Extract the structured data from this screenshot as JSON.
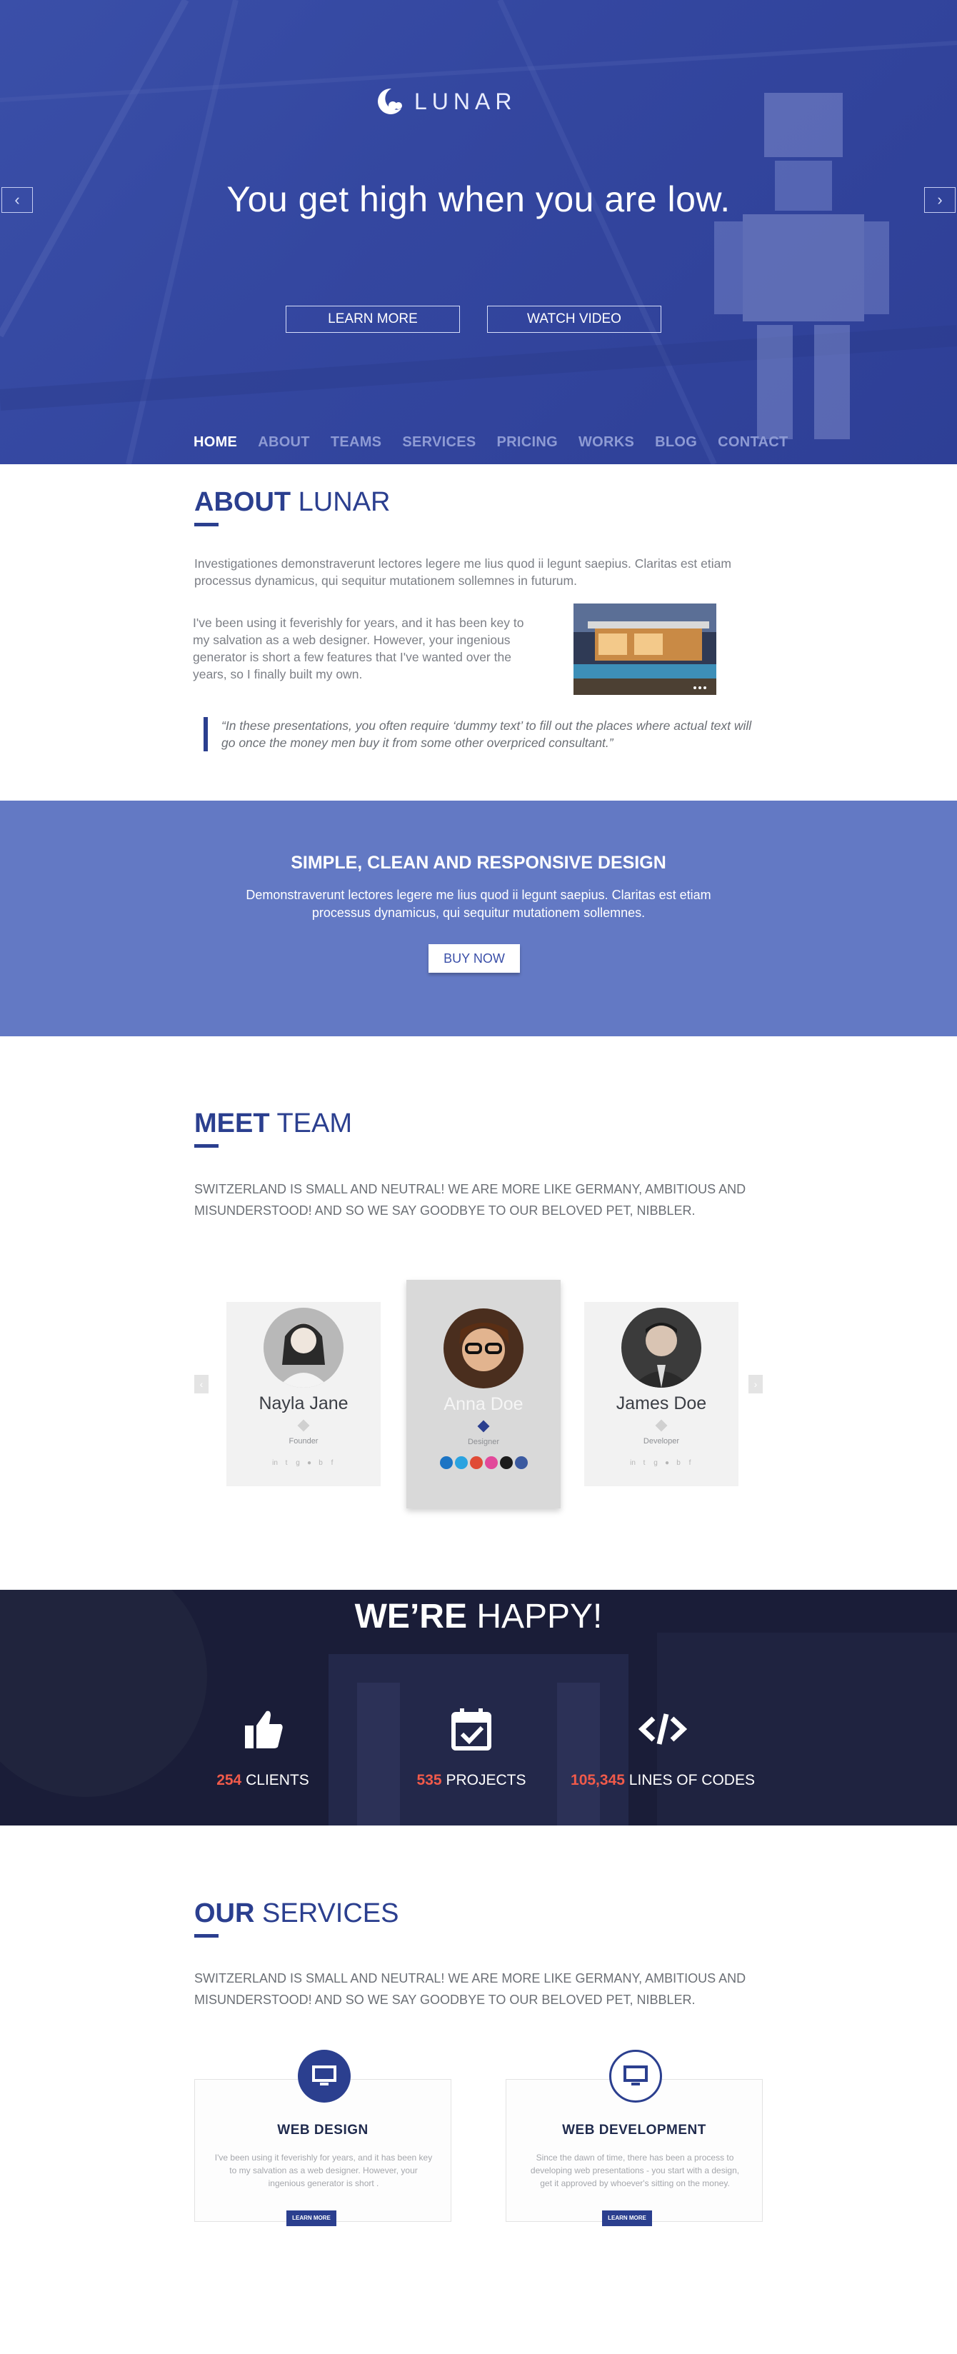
{
  "hero": {
    "logo_text": "LUNAR",
    "title": "You get high when you are low.",
    "learn_more": "LEARN MORE",
    "watch_video": "WATCH VIDEO"
  },
  "nav": {
    "items": [
      "HOME",
      "ABOUT",
      "TEAMS",
      "SERVICES",
      "PRICING",
      "WORKS",
      "BLOG",
      "CONTACT"
    ],
    "active": "HOME"
  },
  "about": {
    "title_bold": "ABOUT",
    "title_light": "LUNAR",
    "intro": "Investigationes demonstraverunt lectores legere me lius quod ii legunt saepius. Claritas est etiam processus dynamicus, qui sequitur mutationem sollemnes in futurum.",
    "body": "I've been using it feverishly for years, and it has been key to my salvation as a web designer. However, your ingenious generator is short a few features that I've wanted over the years, so I finally built my own.",
    "quote": "“In these presentations, you often require ‘dummy text’ to fill out the places where actual text will go once the money men buy it from some other overpriced consultant.”"
  },
  "banner": {
    "title": "SIMPLE, CLEAN AND RESPONSIVE DESIGN",
    "text": "Demonstraverunt lectores legere me lius quod ii legunt saepius. Claritas est etiam processus dynamicus, qui sequitur mutationem sollemnes.",
    "button": "BUY NOW"
  },
  "team": {
    "title_bold": "MEET",
    "title_light": "TEAM",
    "text": "SWITZERLAND IS SMALL AND NEUTRAL! WE ARE MORE LIKE GERMANY, AMBITIOUS AND MISUNDERSTOOD! AND SO WE SAY GOODBYE TO OUR BELOVED PET, NIBBLER.",
    "members": [
      {
        "name": "Nayla Jane",
        "role": "Founder"
      },
      {
        "name": "Anna Doe",
        "role": "Designer"
      },
      {
        "name": "James Doe",
        "role": "Developer"
      }
    ]
  },
  "happy": {
    "title_bold": "WE’RE",
    "title_light": "HAPPY!",
    "stats": [
      {
        "num": "254",
        "label": "CLIENTS",
        "icon": "thumbs-up-icon"
      },
      {
        "num": "535",
        "label": "PROJECTS",
        "icon": "calendar-check-icon"
      },
      {
        "num": "105,345",
        "label": "LINES OF CODES",
        "icon": "code-icon"
      }
    ]
  },
  "services": {
    "title_bold": "OUR",
    "title_light": "SERVICES",
    "text": "SWITZERLAND IS SMALL AND NEUTRAL! WE ARE MORE LIKE GERMANY, AMBITIOUS AND MISUNDERSTOOD! AND SO WE SAY GOODBYE TO OUR BELOVED PET, NIBBLER.",
    "items": [
      {
        "title": "WEB DESIGN",
        "desc": "I've been using it feverishly for years, and it has been key to my salvation as a web designer. However, your ingenious generator is short .",
        "button": "LEARN MORE"
      },
      {
        "title": "WEB DEVELOPMENT",
        "desc": "Since the dawn of time, there has been a process to developing web presentations - you start with a design, get it approved by whoever's sitting on the money.",
        "button": "LEARN MORE"
      }
    ]
  },
  "colors": {
    "brand_blue": "#2b3f8f",
    "banner_blue": "#6379c4",
    "hero_blue": "#3a4fa8",
    "accent_red": "#f05a4a",
    "dark_navy": "#191c35"
  }
}
